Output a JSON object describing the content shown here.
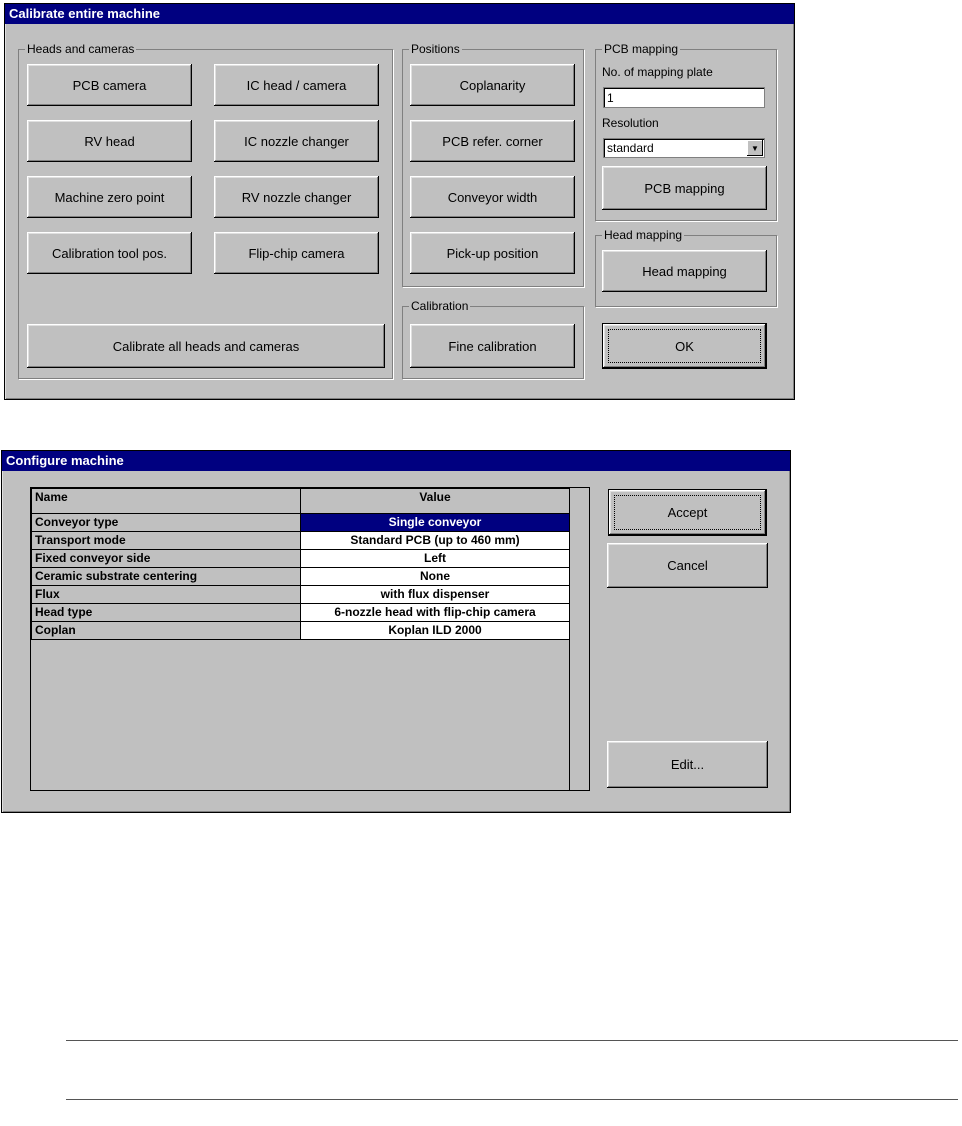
{
  "calibrate": {
    "title": "Calibrate entire machine",
    "heads_group": "Heads and cameras",
    "heads_buttons": [
      "PCB camera",
      "IC head / camera",
      "RV head",
      "IC nozzle changer",
      "Machine zero point",
      "RV nozzle changer",
      "Calibration tool pos.",
      "Flip-chip camera"
    ],
    "calibrate_all": "Calibrate all heads and cameras",
    "positions_group": "Positions",
    "positions_buttons": [
      "Coplanarity",
      "PCB refer. corner",
      "Conveyor width",
      "Pick-up position"
    ],
    "calibration_group": "Calibration",
    "fine_calibration": "Fine calibration",
    "pcb_mapping_group": "PCB mapping",
    "mapping_plate_label": "No. of mapping plate",
    "mapping_plate_value": "1",
    "resolution_label": "Resolution",
    "resolution_value": "standard",
    "pcb_mapping_button": "PCB mapping",
    "head_mapping_group": "Head mapping",
    "head_mapping_button": "Head mapping",
    "ok_button": "OK"
  },
  "configure": {
    "title": "Configure machine",
    "columns": [
      "Name",
      "Value"
    ],
    "rows": [
      {
        "name": "Conveyor type",
        "value": "Single conveyor"
      },
      {
        "name": "Transport mode",
        "value": "Standard PCB (up to 460 mm)"
      },
      {
        "name": "Fixed conveyor side",
        "value": "Left"
      },
      {
        "name": "Ceramic substrate centering",
        "value": "None"
      },
      {
        "name": "Flux",
        "value": "with flux dispenser"
      },
      {
        "name": "Head type",
        "value": "6-nozzle head with flip-chip camera"
      },
      {
        "name": "Coplan",
        "value": "Koplan ILD 2000"
      }
    ],
    "selected_row": 0,
    "accept_button": "Accept",
    "cancel_button": "Cancel",
    "edit_button": "Edit..."
  },
  "colors": {
    "titlebar": "#000080",
    "dialog_face": "#c0c0c0",
    "selection": "#000080"
  }
}
